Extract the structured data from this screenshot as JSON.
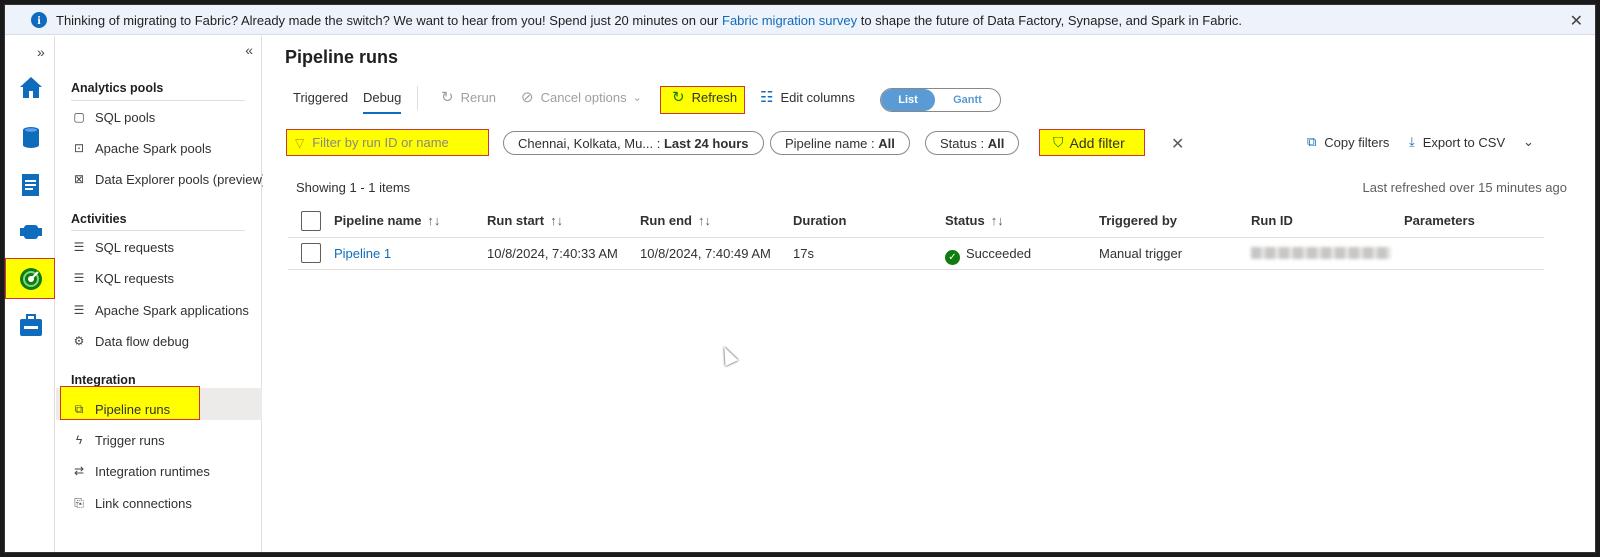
{
  "banner": {
    "text_before": "Thinking of migrating to Fabric? Already made the switch? We want to hear from you! Spend just 20 minutes on our ",
    "link": "Fabric migration survey",
    "text_after": " to shape the future of Data Factory, Synapse, and Spark in Fabric."
  },
  "rail": {
    "icons": [
      "home-icon",
      "data-icon",
      "develop-icon",
      "integrate-icon",
      "monitor-icon",
      "manage-icon"
    ]
  },
  "sidebar": {
    "sections": [
      {
        "title": "Analytics pools",
        "items": [
          "SQL pools",
          "Apache Spark pools",
          "Data Explorer pools (preview)"
        ]
      },
      {
        "title": "Activities",
        "items": [
          "SQL requests",
          "KQL requests",
          "Apache Spark applications",
          "Data flow debug"
        ]
      },
      {
        "title": "Integration",
        "items": [
          "Pipeline runs",
          "Trigger runs",
          "Integration runtimes",
          "Link connections"
        ]
      }
    ],
    "selected": "Pipeline runs"
  },
  "main": {
    "title": "Pipeline runs",
    "tabs": [
      "Triggered",
      "Debug"
    ],
    "active_tab": "Debug",
    "toolbar": {
      "rerun": "Rerun",
      "cancel": "Cancel options",
      "refresh": "Refresh",
      "edit_columns": "Edit columns",
      "view_list": "List",
      "view_gantt": "Gantt"
    },
    "filters": {
      "search_placeholder": "Filter by run ID or name",
      "timezone": "Chennai, Kolkata, Mu...",
      "timezone_value": "Last 24 hours",
      "pipeline_label": "Pipeline name",
      "pipeline_value": "All",
      "status_label": "Status",
      "status_value": "All",
      "add_filter": "Add filter",
      "copy_filters": "Copy filters",
      "export": "Export to CSV"
    },
    "showing": "Showing 1 - 1 items",
    "refreshed": "Last refreshed over 15 minutes ago",
    "columns": [
      "Pipeline name",
      "Run start",
      "Run end",
      "Duration",
      "Status",
      "Triggered by",
      "Run ID",
      "Parameters"
    ],
    "rows": [
      {
        "pipeline_name": "Pipeline 1",
        "run_start": "10/8/2024, 7:40:33 AM",
        "run_end": "10/8/2024, 7:40:49 AM",
        "duration": "17s",
        "status": "Succeeded",
        "triggered_by": "Manual trigger",
        "run_id": "",
        "parameters": ""
      }
    ]
  },
  "colors": {
    "accent": "#0f6cbd",
    "highlight": "#ffff00",
    "highlight_border": "#d13438",
    "success": "#107c10"
  }
}
